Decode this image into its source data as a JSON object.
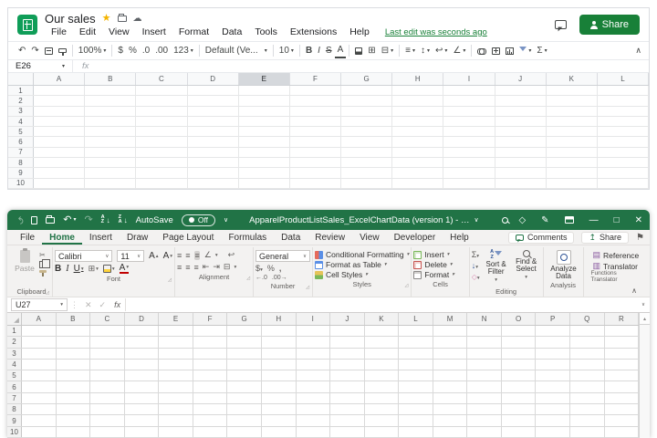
{
  "icons": {
    "undo": "↶",
    "redo": "↷",
    "dropdown": "▾",
    "star": "★",
    "cloud": "☁",
    "collapse": "∧",
    "chev_down": "∨",
    "sigma": "Σ",
    "grid": "⊞",
    "merge": "⊟",
    "align": "≡",
    "valign": "↕",
    "wrap": "↩",
    "rotate": "∠",
    "launcher": "◿",
    "close": "✕",
    "maximize": "□",
    "minimize": "—",
    "check": "✓",
    "cancel": "✕",
    "scissors": "✂",
    "pencil": "✎",
    "gem": "◇",
    "flag": "⚑",
    "book": "▤",
    "translate": "▥",
    "dots": "⋮",
    "down": "↓",
    "left": "←",
    "right": "→",
    "indent_dec": "⇤",
    "indent_inc": "⇥",
    "comma": ",",
    "dollar": "$",
    "percent": "%",
    "sort_a": "A",
    "sort_z": "Z",
    "scroll_up": "▴",
    "share_up": "↥",
    "tri_up": "▴"
  },
  "google_sheets": {
    "title": "Our sales",
    "menu": [
      "File",
      "Edit",
      "View",
      "Insert",
      "Format",
      "Data",
      "Tools",
      "Extensions",
      "Help"
    ],
    "last_edit": "Last edit was seconds ago",
    "share_button": "Share",
    "toolbar": {
      "zoom": "100%",
      "dollar": "$",
      "percent": "%",
      "dec0": ".0",
      "dec00": ".00",
      "format": "123",
      "font": "Default (Ve...",
      "font_size": "10",
      "bold": "B",
      "italic": "I",
      "strike": "S",
      "text_color": "A"
    },
    "formula_bar": {
      "name_box": "E26",
      "fx": "fx"
    },
    "grid": {
      "columns": [
        "A",
        "B",
        "C",
        "D",
        "E",
        "F",
        "G",
        "H",
        "I",
        "J",
        "K",
        "L"
      ],
      "rows": [
        "1",
        "2",
        "3",
        "4",
        "5",
        "6",
        "7",
        "8",
        "9",
        "10"
      ],
      "highlighted_column": "E"
    }
  },
  "excel": {
    "titlebar": {
      "autosave_label": "AutoSave",
      "autosave_state": "Off",
      "document_title": "ApparelProductListSales_ExcelChartData (version 1) - …"
    },
    "tabs": [
      "File",
      "Home",
      "Insert",
      "Draw",
      "Page Layout",
      "Formulas",
      "Data",
      "Review",
      "View",
      "Developer",
      "Help"
    ],
    "active_tab": "Home",
    "comments_button": "Comments",
    "share_button": "Share",
    "ribbon": {
      "paste": "Paste",
      "clipboard_label": "Clipboard",
      "font_name": "Calibri",
      "font_size": "11",
      "font_label": "Font",
      "alignment_label": "Alignment",
      "number_format": "General",
      "number_label": "Number",
      "styles": [
        "Conditional Formatting",
        "Format as Table",
        "Cell Styles"
      ],
      "styles_label": "Styles",
      "cells": [
        "Insert",
        "Delete",
        "Format"
      ],
      "cells_label": "Cells",
      "sort_filter": "Sort & Filter",
      "find_select": "Find & Select",
      "editing_label": "Editing",
      "analyze_data": "Analyze Data",
      "analysis_label": "Analysis",
      "reference": "Reference",
      "translator": "Translator",
      "functions_translator_label": "Functions Translator"
    },
    "formula_bar": {
      "name_box": "U27",
      "fx": "fx"
    },
    "grid": {
      "columns": [
        "A",
        "B",
        "C",
        "D",
        "E",
        "F",
        "G",
        "H",
        "I",
        "J",
        "K",
        "L",
        "M",
        "N",
        "O",
        "P",
        "Q",
        "R"
      ],
      "rows": [
        "1",
        "2",
        "3",
        "4",
        "5",
        "6",
        "7",
        "8",
        "9",
        "10"
      ]
    }
  },
  "colors": {
    "sheets_logo_green": "#0f9d58",
    "sheets_share_green": "#188038",
    "star_yellow": "#f4b400",
    "excel_green": "#217346"
  }
}
